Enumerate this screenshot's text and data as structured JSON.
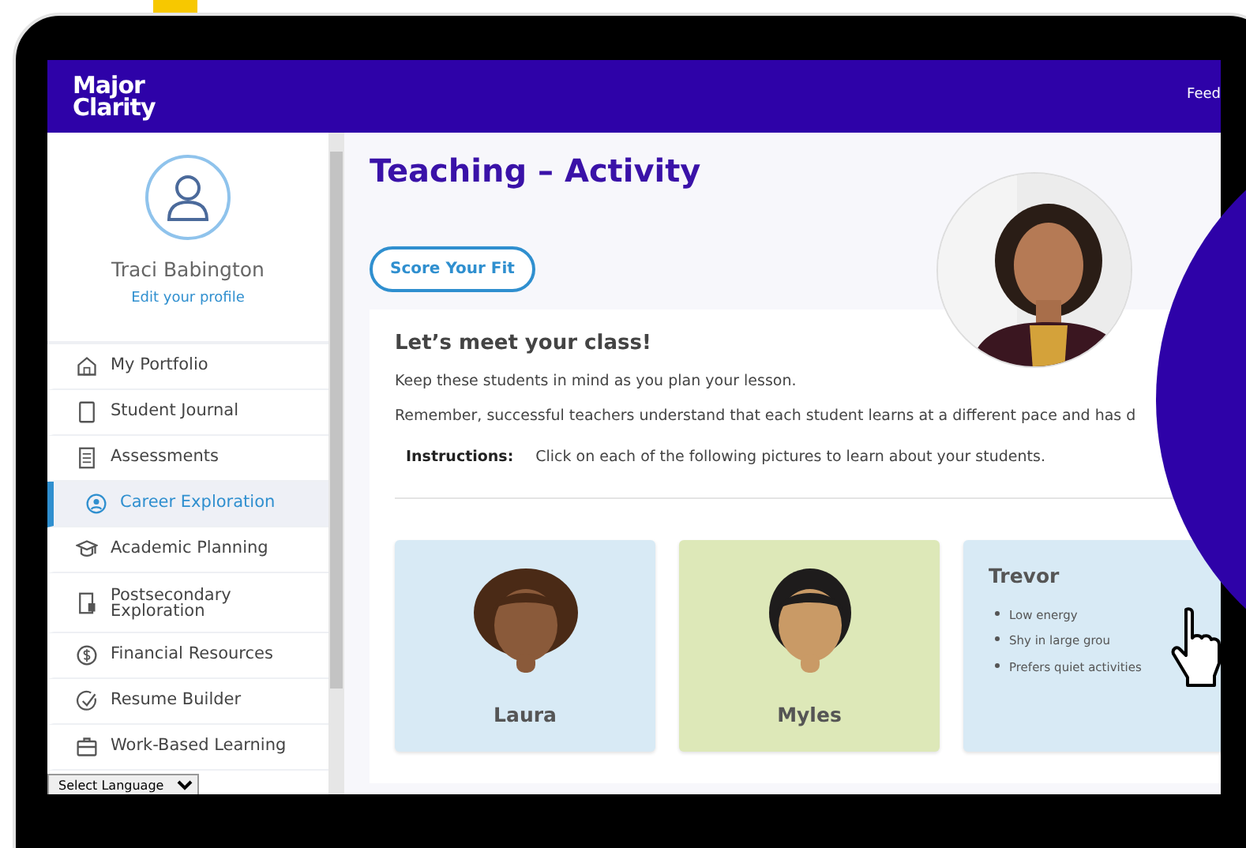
{
  "header": {
    "logo_line_1": "Major",
    "logo_line_2": "Clarity",
    "link": "Feed"
  },
  "profile": {
    "name": "Traci Babington",
    "edit_link": "Edit your profile"
  },
  "sidebar": {
    "items": [
      {
        "label": "My Portfolio",
        "selected": false
      },
      {
        "label": "Student Journal",
        "selected": false
      },
      {
        "label": "Assessments",
        "selected": false
      },
      {
        "label": "Career Exploration",
        "selected": true
      },
      {
        "label": "Academic Planning",
        "selected": false
      },
      {
        "label": "Postsecondary Exploration",
        "selected": false
      },
      {
        "label": "Financial Resources",
        "selected": false
      },
      {
        "label": "Resume Builder",
        "selected": false
      },
      {
        "label": "Work-Based Learning",
        "selected": false
      }
    ]
  },
  "language_select": {
    "value": "Select Language"
  },
  "page": {
    "title": "Teaching – Activity",
    "button": "Score Your Fit"
  },
  "intro": {
    "heading": "Let’s meet your class!",
    "paragraphs": [
      "Keep these students in mind as you plan your lesson.",
      "Remember, successful teachers understand that each student learns at a different pace and has d"
    ],
    "instructions_label": "Instructions:",
    "instructions_text": "Click on each of the following pictures to learn about your students."
  },
  "students": [
    {
      "name": "Laura",
      "kind": "avatar",
      "color": "#d8eaf5"
    },
    {
      "name": "Myles",
      "kind": "avatar",
      "color": "#dde8b8"
    },
    {
      "name": "Trevor",
      "kind": "details",
      "color": "#d8eaf5",
      "traits": [
        "Low energy",
        "Shy in large grou",
        "Prefers quiet activities"
      ]
    }
  ]
}
